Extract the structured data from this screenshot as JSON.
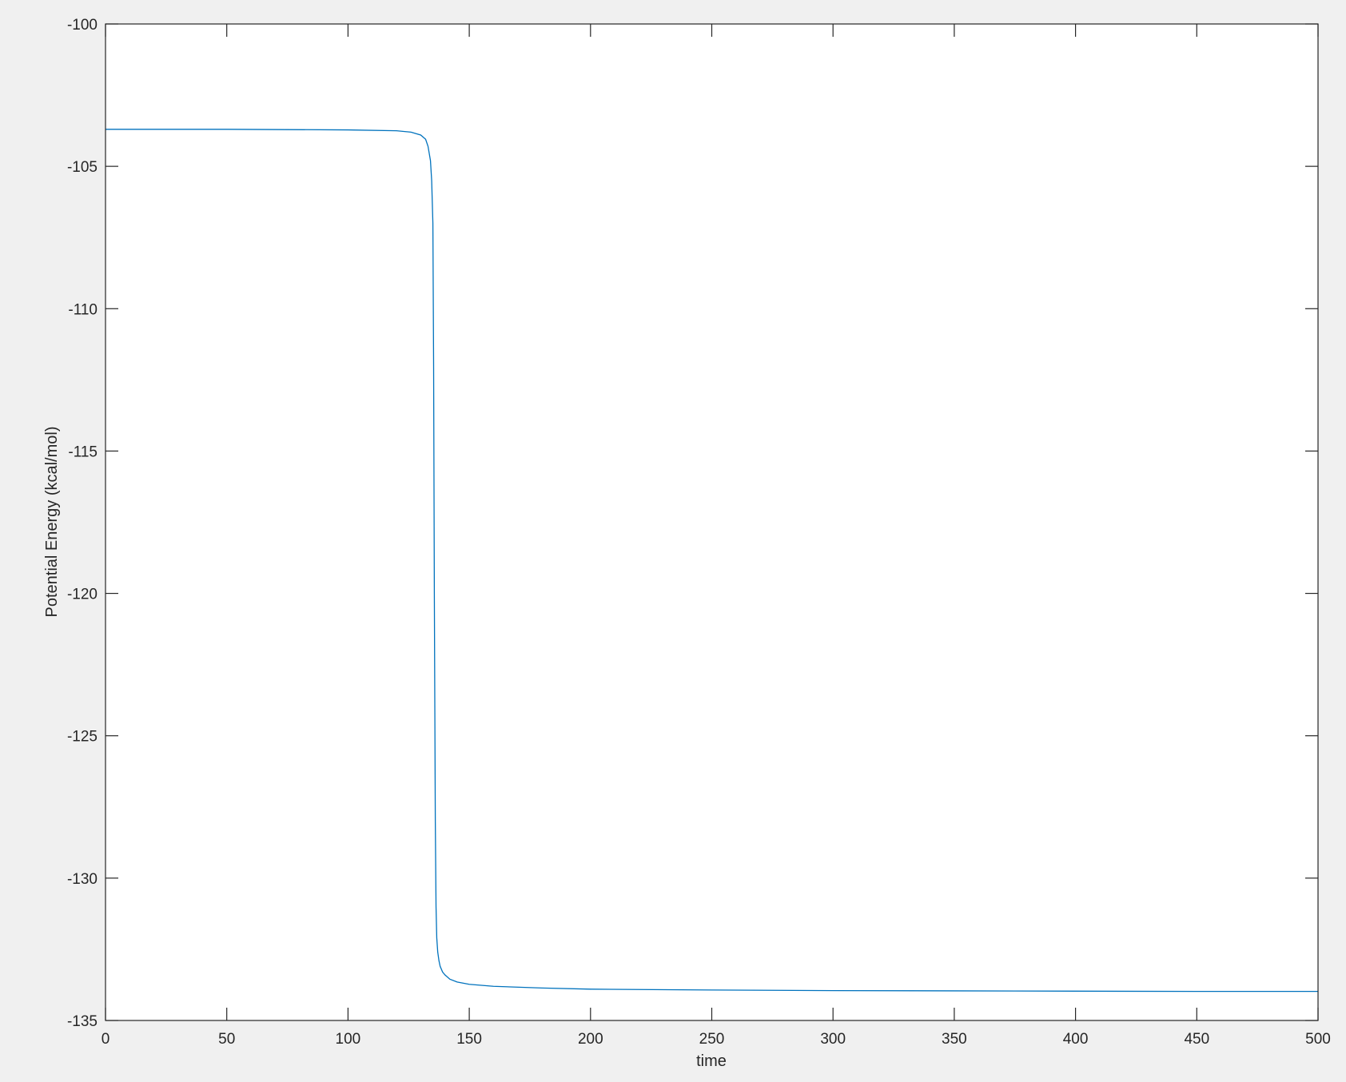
{
  "chart_data": {
    "type": "line",
    "title": "",
    "xlabel": "time",
    "ylabel": "Potential Energy (kcal/mol)",
    "xlim": [
      0,
      500
    ],
    "ylim": [
      -135,
      -100
    ],
    "xticks": [
      0,
      50,
      100,
      150,
      200,
      250,
      300,
      350,
      400,
      450,
      500
    ],
    "yticks": [
      -135,
      -130,
      -125,
      -120,
      -115,
      -110,
      -105,
      -100
    ],
    "grid": false,
    "colors": {
      "line": "#0072bd",
      "axis": "#262626",
      "background": "#f0f0f0",
      "plot": "#ffffff"
    },
    "series": [
      {
        "name": "Potential Energy",
        "x": [
          0,
          50,
          100,
          120,
          126,
          130,
          132,
          133,
          134,
          134.5,
          135,
          135.3,
          135.6,
          136,
          136.3,
          136.6,
          137,
          137.5,
          138,
          139,
          140,
          142,
          145,
          150,
          160,
          180,
          200,
          250,
          300,
          350,
          400,
          450,
          500
        ],
        "y": [
          -103.7,
          -103.7,
          -103.72,
          -103.75,
          -103.8,
          -103.9,
          -104.05,
          -104.3,
          -104.8,
          -105.5,
          -107,
          -112,
          -120,
          -128,
          -131,
          -132.1,
          -132.6,
          -132.9,
          -133.1,
          -133.3,
          -133.4,
          -133.55,
          -133.65,
          -133.73,
          -133.8,
          -133.86,
          -133.9,
          -133.93,
          -133.95,
          -133.96,
          -133.97,
          -133.98,
          -133.98
        ]
      }
    ]
  }
}
